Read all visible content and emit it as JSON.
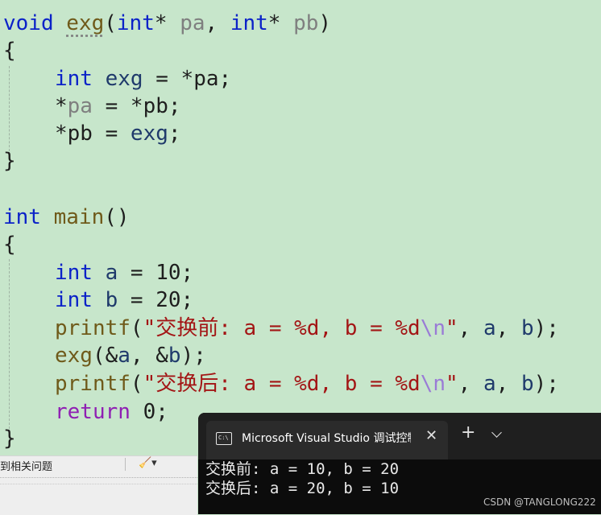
{
  "code": {
    "l1": {
      "kw": "void",
      "fn": "exg",
      "p1": "(",
      "kw2": "int",
      "p2": "* ",
      "pa": "pa",
      "p3": ", ",
      "kw3": "int",
      "p4": "* ",
      "pb": "pb",
      "p5": ")"
    },
    "l2": "{",
    "l3": {
      "kw": "int",
      "v": "exg",
      "rest": " = *pa;"
    },
    "l4": {
      "star": "*",
      "pa": "pa",
      "rest": " = *pb;"
    },
    "l5": {
      "star": "*pb = ",
      "v": "exg",
      "end": ";"
    },
    "l6": "}",
    "l8": {
      "kw": "int",
      "fn": "main",
      "rest": "()"
    },
    "l9": "{",
    "l10": {
      "kw": "int",
      "v": "a",
      "rest": " = 10;"
    },
    "l11": {
      "kw": "int",
      "v": "b",
      "rest": " = 20;"
    },
    "l12": {
      "fn": "printf",
      "p": "(",
      "s": "\"交换前: a = %d, b = %d",
      "esc": "\\n",
      "s2": "\"",
      ",": ", ",
      "a": "a",
      "c": ", ",
      "b": "b",
      "end": ");"
    },
    "l13": {
      "fn": "exg",
      "rest1": "(&",
      "a": "a",
      "rest2": ", &",
      "b": "b",
      "end": ");"
    },
    "l14": {
      "fn": "printf",
      "p": "(",
      "s": "\"交换后: a = %d, b = %d",
      "esc": "\\n",
      "s2": "\"",
      ",": ", ",
      "a": "a",
      "c": ", ",
      "b": "b",
      "end": ");"
    },
    "l15": {
      "kw": "return",
      "rest": " 0;"
    },
    "l16": "}"
  },
  "statusbar": {
    "label": "到相关问题",
    "brush": "🧹▾"
  },
  "console": {
    "tab_title": "Microsoft Visual Studio 调试控制台",
    "icon_text": "C:\\",
    "close": "✕",
    "new_tab": "+",
    "output": [
      "交换前: a = 10, b = 20",
      "交换后: a = 20, b = 10"
    ],
    "watermark": "CSDN @TANGLONG222"
  }
}
